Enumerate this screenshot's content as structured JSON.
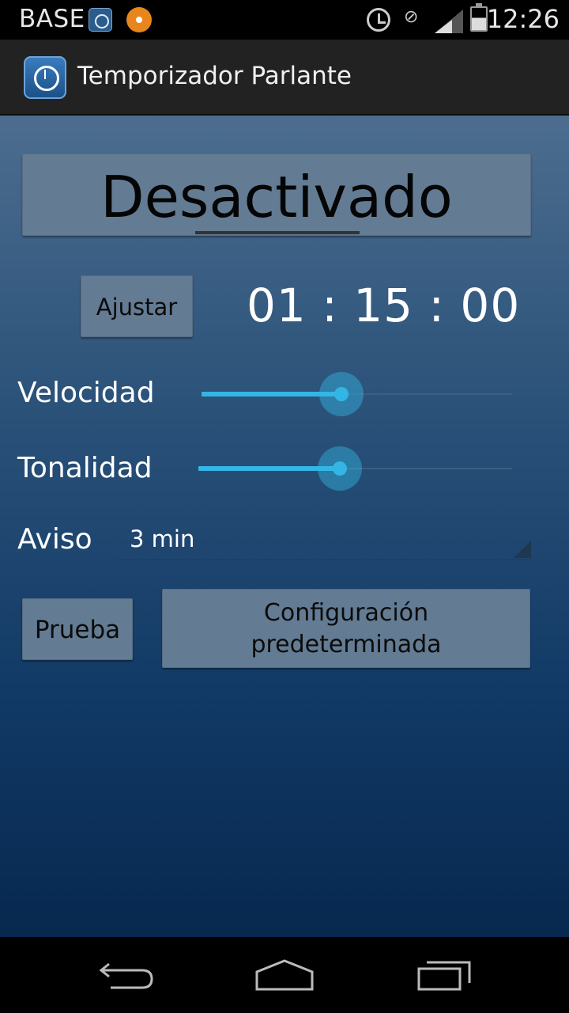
{
  "status_bar": {
    "carrier": "BASE",
    "time": "12:26",
    "icons": [
      "timer-app-icon",
      "circle-app-icon",
      "alarm-icon",
      "no-sim-icon",
      "signal-icon",
      "battery-icon"
    ]
  },
  "action_bar": {
    "title": "Temporizador Parlante",
    "icon": "stopwatch-logo-icon"
  },
  "main": {
    "status_button_label": "Desactivado",
    "adjust_button_label": "Ajustar",
    "time_display": "01 : 15 : 00",
    "speed": {
      "label": "Velocidad",
      "value": 0.45
    },
    "pitch": {
      "label": "Tonalidad",
      "value": 0.45
    },
    "warning": {
      "label": "Aviso",
      "selected": "3 min"
    },
    "test_button_label": "Prueba",
    "default_config_line1": "Configuración",
    "default_config_line2": "predeterminada"
  },
  "nav_bar": {
    "icons": [
      "back-icon",
      "home-icon",
      "recents-icon"
    ]
  },
  "colors": {
    "accent": "#33b5e5",
    "button_bg": "#637b93",
    "actionbar_bg": "#222222"
  }
}
